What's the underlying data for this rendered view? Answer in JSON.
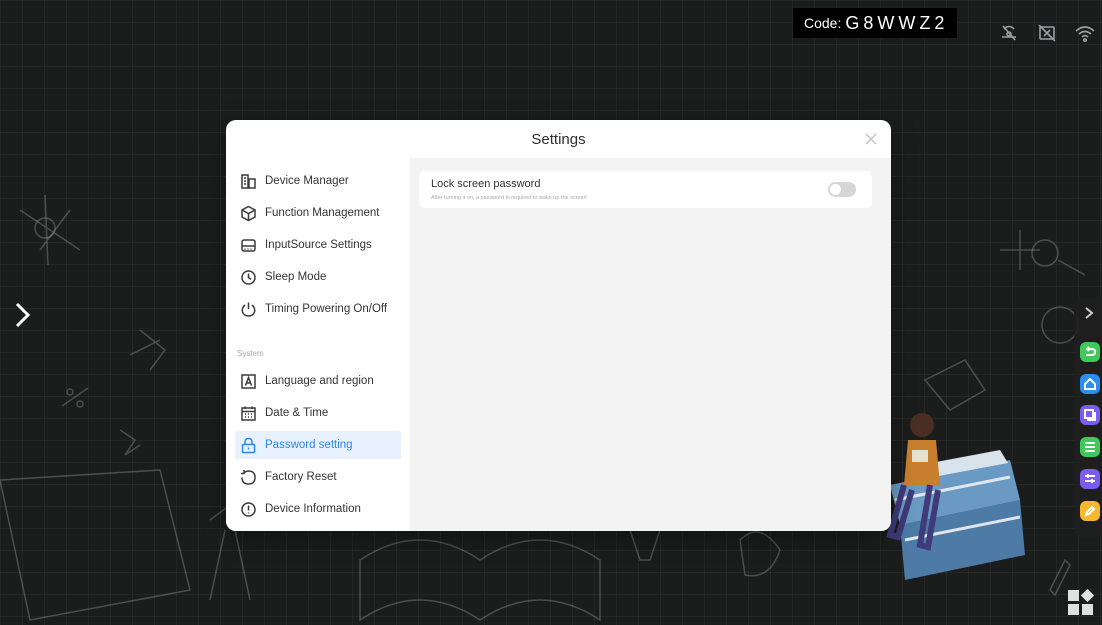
{
  "topbar": {
    "code_label": "Code:",
    "code_value": "G8WWZ2"
  },
  "status_icons": [
    "hotspot-off-icon",
    "screen-share-off-icon",
    "wifi-icon"
  ],
  "dialog": {
    "title": "Settings",
    "sidebar": {
      "items": [
        {
          "label": "Device Manager",
          "icon": "device-manager-icon"
        },
        {
          "label": "Function Management",
          "icon": "cube-icon"
        },
        {
          "label": "InputSource Settings",
          "icon": "input-source-icon"
        },
        {
          "label": "Sleep Mode",
          "icon": "clock-icon"
        },
        {
          "label": "Timing Powering On/Off",
          "icon": "power-icon"
        }
      ],
      "section_label": "System",
      "system_items": [
        {
          "label": "Language and region",
          "icon": "language-icon"
        },
        {
          "label": "Date & Time",
          "icon": "calendar-icon"
        },
        {
          "label": "Password setting",
          "icon": "lock-icon",
          "active": true
        },
        {
          "label": "Factory Reset",
          "icon": "reset-icon"
        },
        {
          "label": "Device Information",
          "icon": "info-icon"
        }
      ]
    },
    "content": {
      "setting_title": "Lock screen password",
      "setting_desc": "After turning it on, a password is required to wake up the screen",
      "toggle_on": false
    }
  },
  "dock": {
    "buttons": [
      {
        "icon": "back-icon",
        "color": "#3ec95a"
      },
      {
        "icon": "home-icon",
        "color": "#2b8ef0"
      },
      {
        "icon": "windows-icon",
        "color": "#7b5cf0"
      },
      {
        "icon": "menu-icon",
        "color": "#3ec95a"
      },
      {
        "icon": "settings-sliders-icon",
        "color": "#7b5cf0"
      },
      {
        "icon": "pen-icon",
        "color": "#f5b82e"
      }
    ]
  }
}
